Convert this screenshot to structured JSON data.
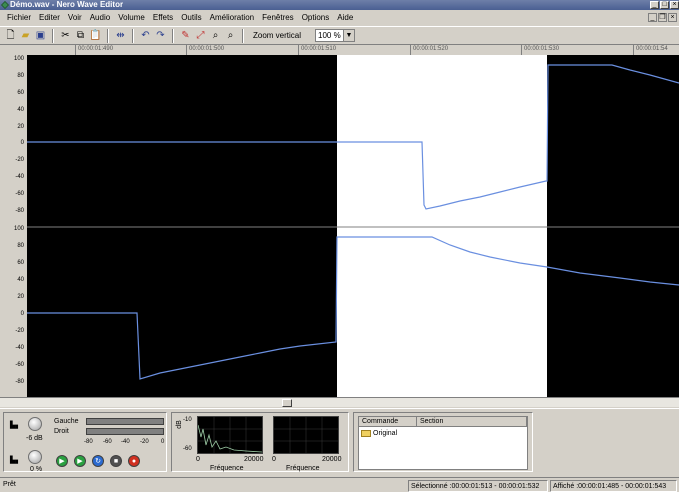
{
  "window": {
    "title": "Démo.wav - Nero Wave Editor",
    "min": "_",
    "max": "□",
    "close": "×"
  },
  "menu": [
    "Fichier",
    "Editer",
    "Voir",
    "Audio",
    "Volume",
    "Effets",
    "Outils",
    "Amélioration",
    "Fenêtres",
    "Options",
    "Aide"
  ],
  "toolbar": {
    "icons": [
      "new-file-icon",
      "open-folder-icon",
      "save-icon",
      "cut-icon",
      "copy-icon",
      "paste-icon",
      "fit-width-icon",
      "undo-icon",
      "redo-icon",
      "marker-icon",
      "zoom-in-icon",
      "zoom-out-icon",
      "zoom-fit-icon"
    ],
    "zoom_label": "Zoom vertical",
    "zoom_value": "100 %"
  },
  "ruler": {
    "labels": [
      "00:00:01:490",
      "00:00:01:500",
      "00:00:01:510",
      "00:00:01:520",
      "00:00:01:530",
      "00:00:01:54"
    ]
  },
  "axis": {
    "top": [
      "100",
      "80",
      "60",
      "40",
      "20",
      "0",
      "-20",
      "-40",
      "-60",
      "-80"
    ],
    "bottom": [
      "100",
      "80",
      "60",
      "40",
      "20",
      "0",
      "-20",
      "-40",
      "-60",
      "-80"
    ]
  },
  "bottom": {
    "volume_label": "-6 dB",
    "pan_label": "0 %",
    "left_label": "Gauche",
    "right_label": "Droit",
    "meter_ticks": [
      "-80",
      "-60",
      "-40",
      "-20",
      "0"
    ],
    "db_label": "dB",
    "db_ticks": [
      "-10",
      "-60"
    ],
    "freq_ticks_1": [
      "0",
      "20000"
    ],
    "freq_ticks_2": [
      "0",
      "20000"
    ],
    "freq_label": "Fréquence",
    "transport_icons": [
      "play-icon",
      "play-selection-icon",
      "loop-icon",
      "stop-icon",
      "record-icon"
    ],
    "list_headers": [
      "Commande",
      "Section"
    ],
    "list_items": [
      "Original"
    ]
  },
  "status": {
    "ready": "Prêt",
    "selected": "Sélectionné :00:00:01:513 - 00:00:01:532",
    "displayed": "Affiché :00:00:01:485 - 00:00:01:543"
  },
  "colors": {
    "waveform": "#6a8fe0",
    "waveform_alt": "#9fcfa8",
    "selection": "#ffffff",
    "background": "#000000"
  }
}
